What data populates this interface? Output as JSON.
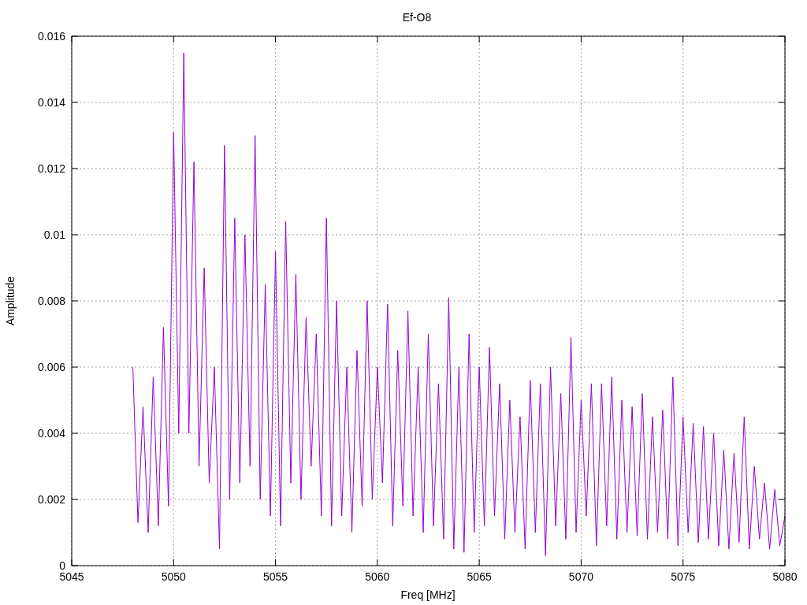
{
  "chart_data": {
    "type": "line",
    "title": "Ef-O8",
    "xlabel": "Freq [MHz]",
    "ylabel": "Amplitude",
    "grid": true,
    "xlim": [
      5045,
      5080
    ],
    "ylim": [
      0,
      0.016
    ],
    "xticks": [
      5045,
      5050,
      5055,
      5060,
      5065,
      5070,
      5075,
      5080
    ],
    "yticks": [
      {
        "value": 0,
        "label": "0"
      },
      {
        "value": 0.002,
        "label": "0.002"
      },
      {
        "value": 0.004,
        "label": "0.004"
      },
      {
        "value": 0.006,
        "label": "0.006"
      },
      {
        "value": 0.008,
        "label": "0.008"
      },
      {
        "value": 0.01,
        "label": "0.01"
      },
      {
        "value": 0.012,
        "label": "0.012"
      },
      {
        "value": 0.014,
        "label": "0.014"
      },
      {
        "value": 0.016,
        "label": "0.016"
      }
    ],
    "x": [
      5048,
      5048.25,
      5048.5,
      5048.75,
      5049,
      5049.25,
      5049.5,
      5049.75,
      5050,
      5050.25,
      5050.5,
      5050.75,
      5051,
      5051.25,
      5051.5,
      5051.75,
      5052,
      5052.25,
      5052.5,
      5052.75,
      5053,
      5053.25,
      5053.5,
      5053.75,
      5054,
      5054.25,
      5054.5,
      5054.75,
      5055,
      5055.25,
      5055.5,
      5055.75,
      5056,
      5056.25,
      5056.5,
      5056.75,
      5057,
      5057.25,
      5057.5,
      5057.75,
      5058,
      5058.25,
      5058.5,
      5058.75,
      5059,
      5059.25,
      5059.5,
      5059.75,
      5060,
      5060.25,
      5060.5,
      5060.75,
      5061,
      5061.25,
      5061.5,
      5061.75,
      5062,
      5062.25,
      5062.5,
      5062.75,
      5063,
      5063.25,
      5063.5,
      5063.75,
      5064,
      5064.25,
      5064.5,
      5064.75,
      5065,
      5065.25,
      5065.5,
      5065.75,
      5066,
      5066.25,
      5066.5,
      5066.75,
      5067,
      5067.25,
      5067.5,
      5067.75,
      5068,
      5068.25,
      5068.5,
      5068.75,
      5069,
      5069.25,
      5069.5,
      5069.75,
      5070,
      5070.25,
      5070.5,
      5070.75,
      5071,
      5071.25,
      5071.5,
      5071.75,
      5072,
      5072.25,
      5072.5,
      5072.75,
      5073,
      5073.25,
      5073.5,
      5073.75,
      5074,
      5074.25,
      5074.5,
      5074.75,
      5075,
      5075.25,
      5075.5,
      5075.75,
      5076,
      5076.25,
      5076.5,
      5076.75,
      5077,
      5077.25,
      5077.5,
      5077.75,
      5078,
      5078.25,
      5078.5,
      5078.75,
      5079,
      5079.25,
      5079.5,
      5079.75,
      5080
    ],
    "series": [
      {
        "color": "#9400d3",
        "values": [
          0.006,
          0.0013,
          0.0048,
          0.001,
          0.0057,
          0.0012,
          0.0072,
          0.0018,
          0.0131,
          0.004,
          0.0155,
          0.004,
          0.0122,
          0.003,
          0.009,
          0.0025,
          0.006,
          0.0005,
          0.0127,
          0.002,
          0.0105,
          0.0025,
          0.01,
          0.003,
          0.013,
          0.002,
          0.0085,
          0.0015,
          0.0095,
          0.0012,
          0.0104,
          0.0025,
          0.0088,
          0.002,
          0.0075,
          0.003,
          0.007,
          0.0015,
          0.0105,
          0.0012,
          0.008,
          0.0015,
          0.006,
          0.001,
          0.0065,
          0.0018,
          0.008,
          0.002,
          0.006,
          0.0025,
          0.0079,
          0.0012,
          0.0065,
          0.0018,
          0.0077,
          0.0015,
          0.006,
          0.001,
          0.007,
          0.0012,
          0.0055,
          0.0008,
          0.0081,
          0.0005,
          0.006,
          0.0004,
          0.007,
          0.001,
          0.006,
          0.0012,
          0.0066,
          0.0015,
          0.0055,
          0.0008,
          0.005,
          0.001,
          0.0045,
          0.0005,
          0.0056,
          0.001,
          0.0055,
          0.0003,
          0.006,
          0.0012,
          0.0052,
          0.0008,
          0.0069,
          0.001,
          0.005,
          0.0015,
          0.0055,
          0.0006,
          0.0055,
          0.0012,
          0.0057,
          0.0008,
          0.005,
          0.001,
          0.0048,
          0.0009,
          0.0052,
          0.0008,
          0.0045,
          0.001,
          0.0047,
          0.0008,
          0.0057,
          0.0006,
          0.0045,
          0.001,
          0.0043,
          0.0007,
          0.0042,
          0.0008,
          0.004,
          0.0006,
          0.0035,
          0.0005,
          0.0034,
          0.0007,
          0.0045,
          0.0005,
          0.003,
          0.0008,
          0.0025,
          0.0005,
          0.0023,
          0.0006,
          0.0015
        ]
      }
    ]
  }
}
